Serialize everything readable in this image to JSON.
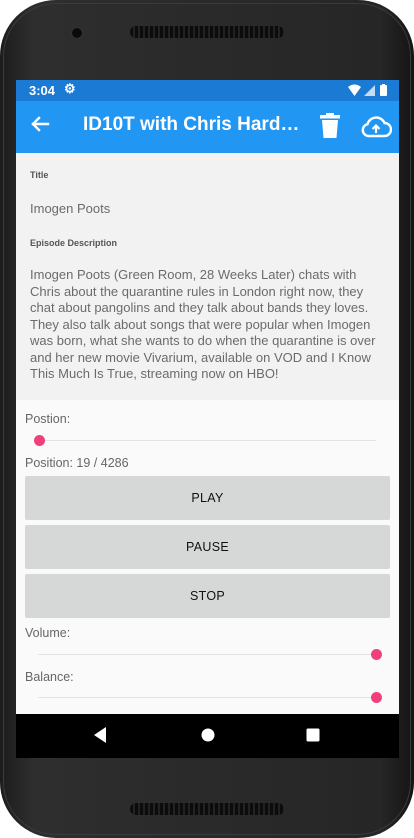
{
  "status_bar": {
    "time": "3:04"
  },
  "app_bar": {
    "title": "ID10T with Chris Hardwi..."
  },
  "details": {
    "title_label": "Title",
    "title_value": "Imogen Poots",
    "description_label": "Episode Description",
    "description_value": "Imogen Poots (Green Room, 28 Weeks Later) chats with Chris about the quarantine rules in London right now, they chat about pangolins and they talk about bands they loves. They also talk about songs that were popular when Imogen was born, what she wants to do when the quarantine is over and her new movie Vivarium, available on VOD and I Know This Much Is True, streaming now on HBO!"
  },
  "player": {
    "position_label": "Postion:",
    "position_text": "Position: 19 / 4286",
    "position_current": 19,
    "position_total": 4286,
    "buttons": {
      "play": "PLAY",
      "pause": "PAUSE",
      "stop": "STOP"
    },
    "volume_label": "Volume:",
    "volume_level": 1.0,
    "balance_label": "Balance:",
    "balance_level": 1.0
  },
  "colors": {
    "status_bar": "#1a7ad4",
    "app_bar": "#2196f3",
    "accent": "#f0407a",
    "button": "#d6d7d7"
  },
  "icons": [
    "settings-icon",
    "wifi-icon",
    "signal-icon",
    "battery-icon",
    "back-arrow-icon",
    "trash-icon",
    "cloud-upload-icon",
    "nav-back-icon",
    "nav-home-icon",
    "nav-recents-icon"
  ]
}
